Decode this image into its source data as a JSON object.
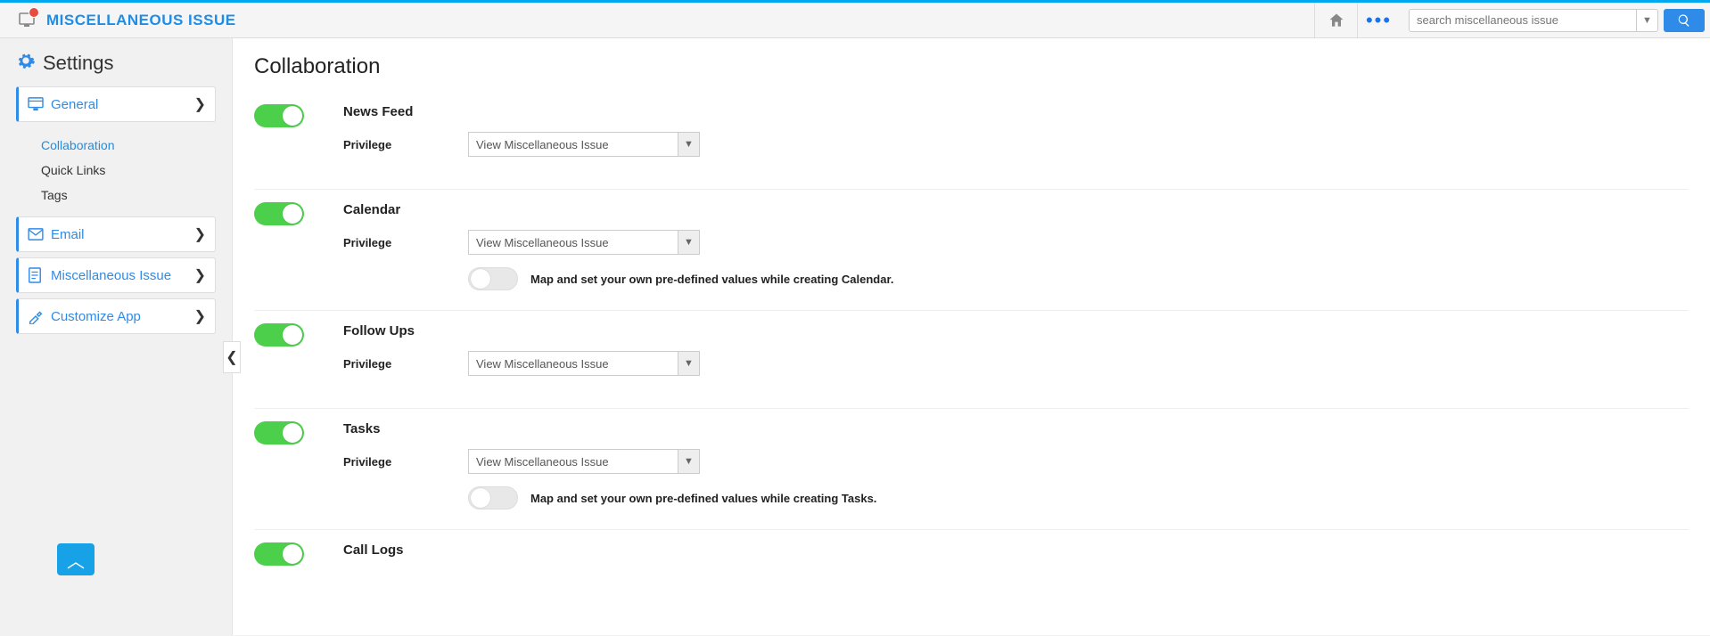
{
  "header": {
    "app_title": "MISCELLANEOUS ISSUE",
    "search_placeholder": "search miscellaneous issue"
  },
  "sidebar": {
    "title": "Settings",
    "items": [
      {
        "label": "General"
      },
      {
        "label": "Email"
      },
      {
        "label": "Miscellaneous Issue"
      },
      {
        "label": "Customize App"
      }
    ],
    "general_sub": [
      {
        "label": "Collaboration",
        "active": true
      },
      {
        "label": "Quick Links",
        "active": false
      },
      {
        "label": "Tags",
        "active": false
      }
    ]
  },
  "main": {
    "title": "Collaboration",
    "privilege_label": "Privilege",
    "privilege_value": "View Miscellaneous Issue",
    "sections": {
      "news_feed": {
        "title": "News Feed"
      },
      "calendar": {
        "title": "Calendar",
        "hint": "Map and set your own pre-defined values while creating Calendar."
      },
      "follow_ups": {
        "title": "Follow Ups"
      },
      "tasks": {
        "title": "Tasks",
        "hint": "Map and set your own pre-defined values while creating Tasks."
      },
      "call_logs": {
        "title": "Call Logs"
      }
    }
  }
}
